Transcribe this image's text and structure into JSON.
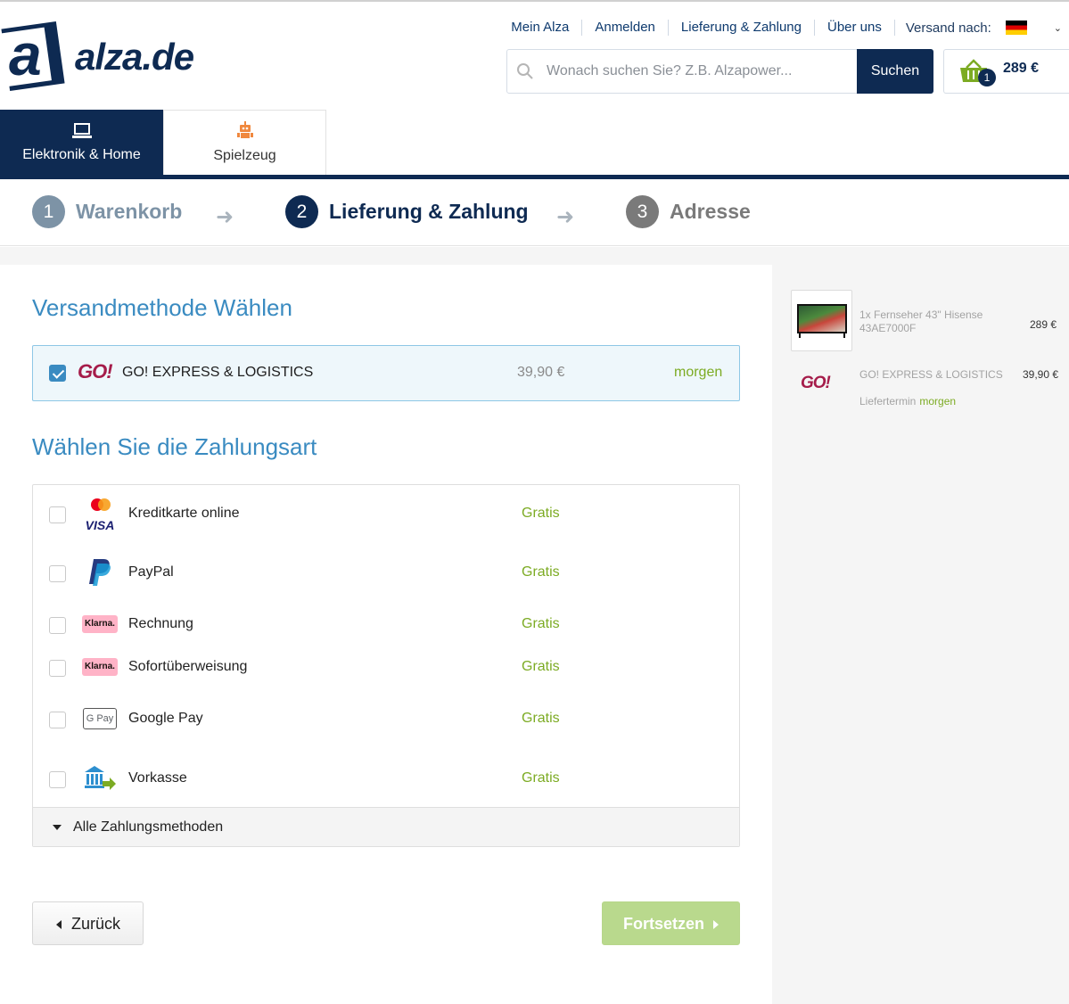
{
  "header": {
    "logo_text": "alza.de",
    "nav": [
      "Mein Alza",
      "Anmelden",
      "Lieferung & Zahlung",
      "Über uns"
    ],
    "ship_to_label": "Versand nach:",
    "search_placeholder": "Wonach suchen Sie? Z.B. Alzapower...",
    "search_button": "Suchen",
    "basket_count": "1",
    "basket_total": "289 €"
  },
  "categories": [
    {
      "label": "Elektronik & Home",
      "icon": "laptop-icon",
      "active": true
    },
    {
      "label": "Spielzeug",
      "icon": "robot-icon",
      "active": false
    }
  ],
  "steps": [
    {
      "num": "1",
      "label": "Warenkorb"
    },
    {
      "num": "2",
      "label": "Lieferung & Zahlung"
    },
    {
      "num": "3",
      "label": "Adresse"
    }
  ],
  "shipping": {
    "title": "Versandmethode Wählen",
    "logo": "GO!",
    "name": "GO! EXPRESS & LOGISTICS",
    "price": "39,90 €",
    "date": "morgen"
  },
  "payment": {
    "title": "Wählen Sie die Zahlungsart",
    "methods": [
      {
        "label": "Kreditkarte online",
        "price": "Gratis",
        "icon": "credit-card-icon"
      },
      {
        "label": "PayPal",
        "price": "Gratis",
        "icon": "paypal-icon"
      },
      {
        "label": "Rechnung",
        "price": "Gratis",
        "icon": "klarna-icon",
        "icon_text": "Klarna."
      },
      {
        "label": "Sofortüberweisung",
        "price": "Gratis",
        "icon": "klarna-icon",
        "icon_text": "Klarna."
      },
      {
        "label": "Google Pay",
        "price": "Gratis",
        "icon": "google-pay-icon",
        "icon_text": "G Pay"
      },
      {
        "label": "Vorkasse",
        "price": "Gratis",
        "icon": "bank-transfer-icon"
      }
    ],
    "all_methods": "Alle Zahlungsmethoden"
  },
  "buttons": {
    "back": "Zurück",
    "continue": "Fortsetzen"
  },
  "summary": {
    "item": "1x Fernseher 43\" Hisense 43AE7000F",
    "item_price": "289 €",
    "ship_name": "GO! EXPRESS & LOGISTICS",
    "ship_price": "39,90 €",
    "delivery_label": "Liefertermin",
    "delivery_when": "morgen"
  },
  "colors": {
    "brand_navy": "#0e2a52",
    "accent_blue": "#3a8bc1",
    "green": "#7cab23",
    "go_logo": "#a51c4a"
  }
}
